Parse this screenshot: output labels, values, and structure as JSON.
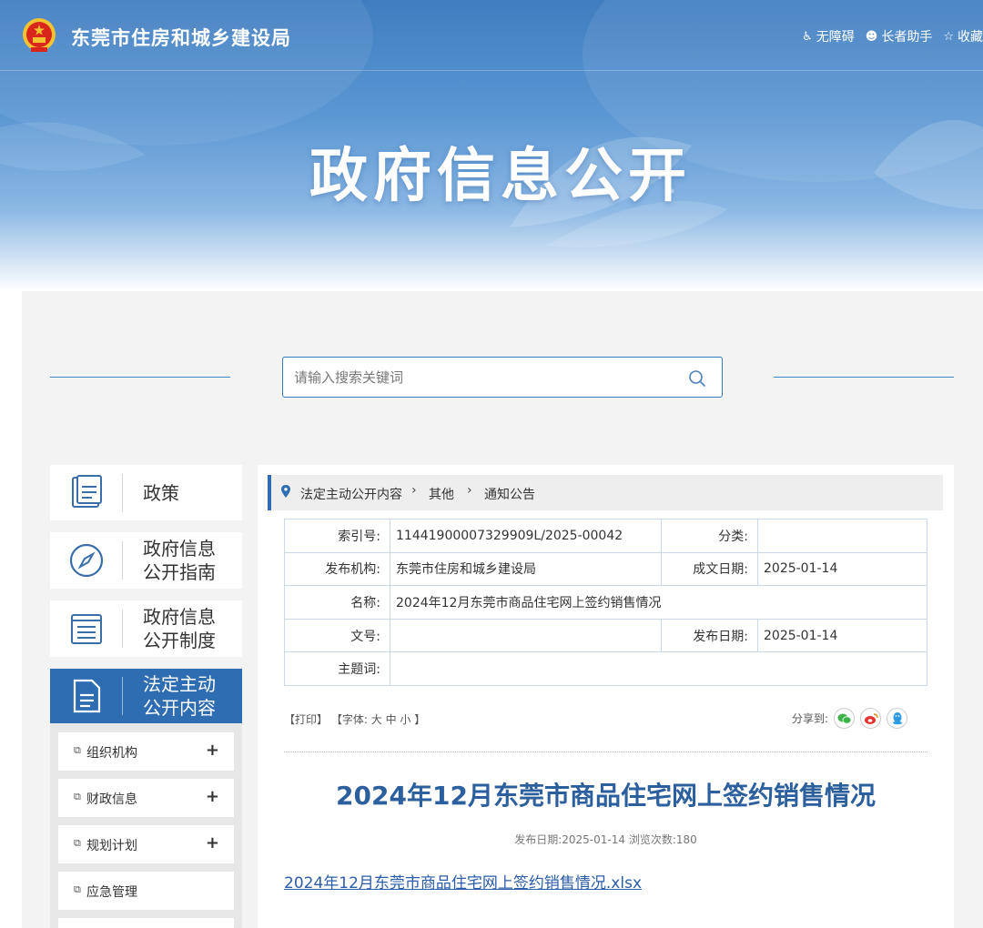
{
  "header": {
    "site_name": "东莞市住房和城乡建设局",
    "banner_title": "政府信息公开",
    "tools": [
      {
        "icon": "wheelchair-icon",
        "label": "无障碍"
      },
      {
        "icon": "elder-icon",
        "label": "长者助手"
      },
      {
        "icon": "star-icon",
        "label": "收藏"
      }
    ]
  },
  "search": {
    "placeholder": "请输入搜索关键词"
  },
  "sidebar": {
    "cards": [
      {
        "label": "政策"
      },
      {
        "label_line1": "政府信息",
        "label_line2": "公开指南"
      },
      {
        "label_line1": "政府信息",
        "label_line2": "公开制度"
      },
      {
        "label_line1": "法定主动",
        "label_line2": "公开内容"
      }
    ],
    "sub_items": [
      {
        "label": "组织机构",
        "expand": "+"
      },
      {
        "label": "财政信息",
        "expand": "+"
      },
      {
        "label": "规划计划",
        "expand": "+"
      },
      {
        "label": "应急管理",
        "expand": ""
      }
    ]
  },
  "breadcrumb": [
    "法定主动公开内容",
    "其他",
    "通知公告"
  ],
  "meta": {
    "index_label": "索引号:",
    "index_value": "11441900007329909L/2025-00042",
    "category_label": "分类:",
    "category_value": "",
    "org_label": "发布机构:",
    "org_value": "东莞市住房和城乡建设局",
    "written_label": "成文日期:",
    "written_value": "2025-01-14",
    "name_label": "名称:",
    "name_value": "2024年12月东莞市商品住宅网上签约销售情况",
    "docno_label": "文号:",
    "docno_value": "",
    "pub_label": "发布日期:",
    "pub_value": "2025-01-14",
    "subject_label": "主题词:",
    "subject_value": ""
  },
  "tools_row": {
    "print": "【打印】",
    "font_prefix": "【字体:",
    "font_large": "大",
    "font_medium": "中",
    "font_small": "小",
    "font_suffix": "】",
    "share_label": "分享到:"
  },
  "article": {
    "title": "2024年12月东莞市商品住宅网上签约销售情况",
    "info": "发布日期:2025-01-14  浏览次数:180",
    "attachment": "2024年12月东莞市商品住宅网上签约销售情况.xlsx"
  },
  "colors": {
    "primary": "#2f6db2",
    "title": "#2c5f9e",
    "link": "#2a5ca8"
  }
}
